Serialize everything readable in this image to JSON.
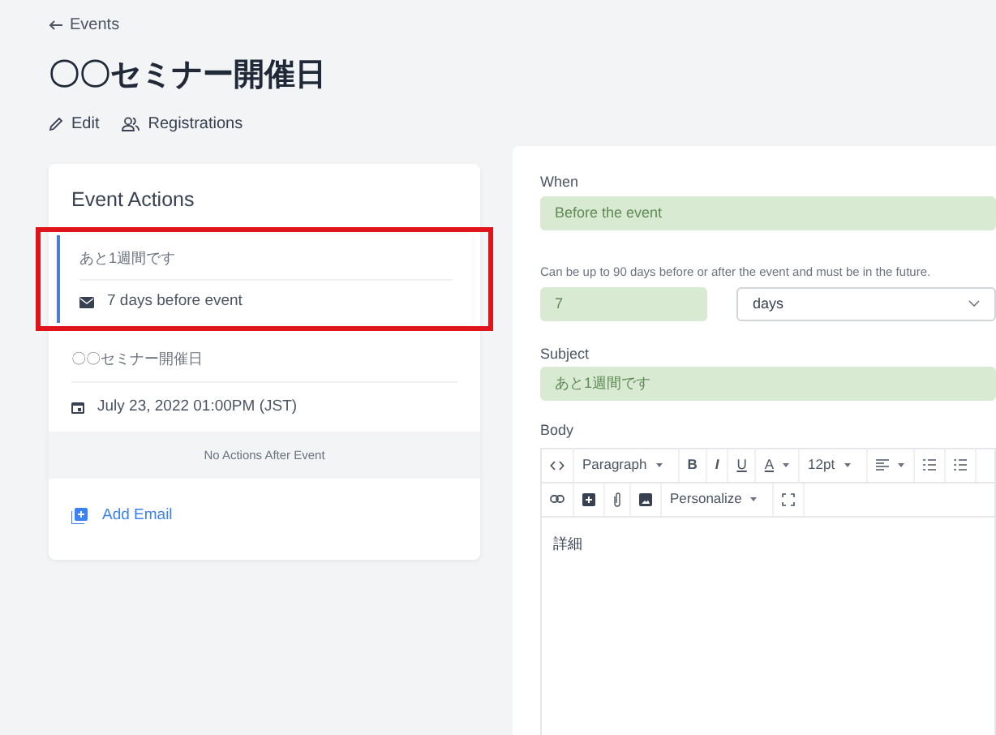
{
  "back_link": {
    "label": "Events"
  },
  "title": "〇〇セミナー開催日",
  "page_actions": [
    {
      "kind": "edit",
      "label": "Edit"
    },
    {
      "kind": "people",
      "label": "Registrations"
    }
  ],
  "event_actions": {
    "title": "Event Actions",
    "before": [
      {
        "subject": "あと1週間です",
        "timing": "7 days before event",
        "selected": true,
        "highlighted": true
      }
    ],
    "event": {
      "name": "〇〇セミナー開催日",
      "date": "July 23, 2022 01:00PM (JST)"
    },
    "after_empty": "No Actions After Event",
    "add_button": "Add Email"
  },
  "form": {
    "when_label": "When",
    "when_value": "Before the event",
    "hint": "Can be up to 90 days before or after the event and must be in the future.",
    "offset_value": "7",
    "unit_value": "days",
    "subject_label": "Subject",
    "subject_value": "あと1週間です",
    "body_label": "Body",
    "toolbar": [
      [
        {
          "kind": "code"
        },
        {
          "kind": "dropdown",
          "label": "Paragraph"
        },
        {
          "kind": "bold",
          "label": "B"
        },
        {
          "kind": "italic",
          "label": "I"
        },
        {
          "kind": "underline",
          "label": "U"
        },
        {
          "kind": "color",
          "label": "A"
        },
        {
          "kind": "dropdown",
          "label": "12pt"
        },
        {
          "kind": "align"
        },
        {
          "kind": "olist"
        },
        {
          "kind": "ulist"
        }
      ],
      [
        {
          "kind": "link"
        },
        {
          "kind": "insert"
        },
        {
          "kind": "attach"
        },
        {
          "kind": "image"
        },
        {
          "kind": "dropdown",
          "label": "Personalize"
        },
        {
          "kind": "fullscreen"
        }
      ]
    ],
    "body_value": "詳細"
  }
}
